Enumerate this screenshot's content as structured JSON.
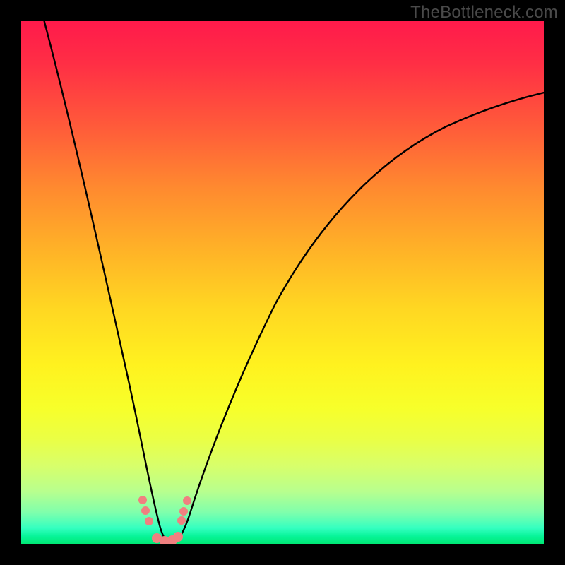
{
  "watermark": "TheBottleneck.com",
  "colors": {
    "frame": "#000000",
    "curve": "#000000",
    "marker": "#f08080",
    "gradient_top": "#ff1a4b",
    "gradient_bottom": "#00e874"
  },
  "chart_data": {
    "type": "line",
    "title": "",
    "xlabel": "",
    "ylabel": "",
    "xlim": [
      0,
      100
    ],
    "ylim": [
      0,
      100
    ],
    "note": "V-shaped bottleneck curve; minimum (green zone) near x≈27. No axis ticks or numeric labels are rendered in the image — only the curve, colored background gradient (red→yellow→green), watermark text, and salmon dot markers near the trough.",
    "series": [
      {
        "name": "bottleneck-curve",
        "x": [
          4,
          8,
          12,
          16,
          20,
          23,
          25,
          27,
          29,
          31,
          34,
          38,
          44,
          52,
          62,
          74,
          88,
          100
        ],
        "y": [
          100,
          79,
          58,
          38,
          19,
          8,
          2,
          0,
          2,
          6,
          14,
          26,
          40,
          54,
          66,
          75,
          81,
          85
        ]
      }
    ],
    "markers": [
      {
        "x": 23.0,
        "y": 8
      },
      {
        "x": 23.6,
        "y": 6
      },
      {
        "x": 24.3,
        "y": 4
      },
      {
        "x": 25.8,
        "y": 0.8
      },
      {
        "x": 27.2,
        "y": 0.4
      },
      {
        "x": 28.6,
        "y": 0.6
      },
      {
        "x": 29.6,
        "y": 1.4
      },
      {
        "x": 30.5,
        "y": 4.5
      },
      {
        "x": 31.0,
        "y": 6
      },
      {
        "x": 31.6,
        "y": 8
      }
    ]
  }
}
